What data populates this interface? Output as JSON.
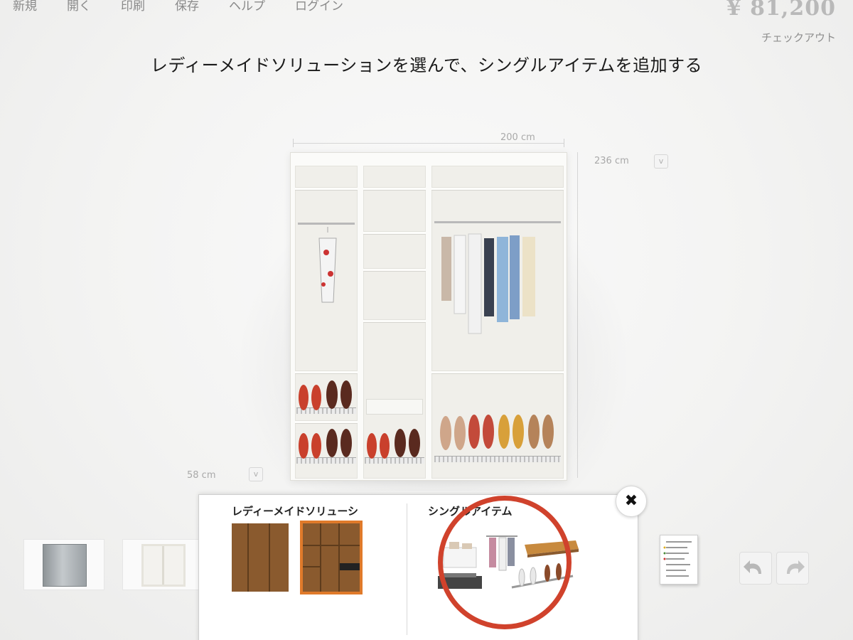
{
  "menu": {
    "items": [
      {
        "label": "新規",
        "name": "menu-new"
      },
      {
        "label": "開く",
        "name": "menu-open"
      },
      {
        "label": "印刷",
        "name": "menu-print"
      },
      {
        "label": "保存",
        "name": "menu-save"
      },
      {
        "label": "ヘルプ",
        "name": "menu-help"
      },
      {
        "label": "ログイン",
        "name": "menu-login"
      }
    ]
  },
  "header": {
    "price": "¥ 81,200",
    "checkout_label": "チェックアウト",
    "headline": "レディーメイドソリューションを選んで、シングルアイテムを追加する"
  },
  "dimensions": {
    "width": "200 cm",
    "height": "236 cm",
    "depth": "58 cm",
    "dropdown_glyph": "v"
  },
  "panel": {
    "readymade_heading": "レディーメイドソリューシ",
    "single_items_heading": "シングルアイテム",
    "close_glyph": "✖",
    "selected_solution_index": 1
  },
  "colors": {
    "accent_orange": "#e07a2a",
    "highlight_red": "#d0422c",
    "wood": "#8a5a2e",
    "price_gray": "#b9b9b9"
  },
  "icons": [
    "close-icon",
    "list-icon",
    "undo-icon",
    "redo-icon",
    "dropdown-icon"
  ]
}
